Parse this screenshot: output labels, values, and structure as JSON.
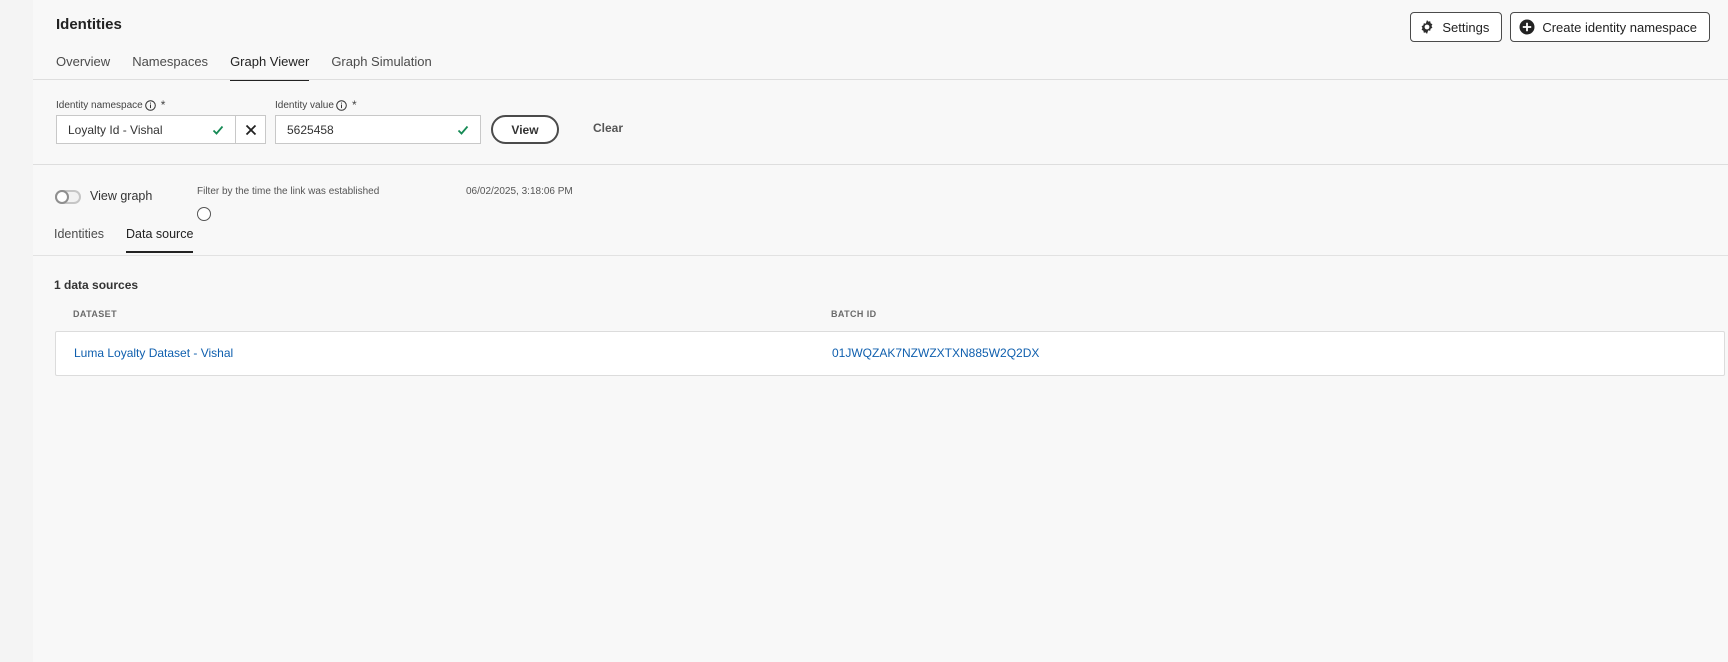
{
  "header": {
    "title": "Identities",
    "settings_label": "Settings",
    "create_label": "Create identity namespace"
  },
  "tabs": [
    {
      "label": "Overview"
    },
    {
      "label": "Namespaces"
    },
    {
      "label": "Graph Viewer"
    },
    {
      "label": "Graph Simulation"
    }
  ],
  "active_tab": "Graph Viewer",
  "form": {
    "namespace_label": "Identity namespace",
    "namespace_value": "Loyalty Id - Vishal",
    "value_label": "Identity value",
    "value_value": "5625458",
    "required_mark": "*",
    "view_label": "View",
    "clear_label": "Clear"
  },
  "graph": {
    "view_graph_label": "View graph",
    "filter_label": "Filter by the time the link was established",
    "timestamp": "06/02/2025, 3:18:06 PM"
  },
  "sub_tabs": [
    {
      "label": "Identities"
    },
    {
      "label": "Data source"
    }
  ],
  "active_sub_tab": "Data source",
  "table": {
    "count_label": "1 data sources",
    "columns": [
      "DATASET",
      "BATCH ID"
    ],
    "rows": [
      {
        "dataset": "Luma Loyalty Dataset - Vishal",
        "batch_id": "01JWQZAK7NZWZXTXN885W2Q2DX"
      }
    ]
  },
  "colors": {
    "accent_text": "#222222",
    "link": "#0f5fae",
    "check_green": "#168a55"
  },
  "icons": [
    "gear-icon",
    "add-circle-icon",
    "info-icon",
    "checkmark-icon",
    "close-icon"
  ]
}
